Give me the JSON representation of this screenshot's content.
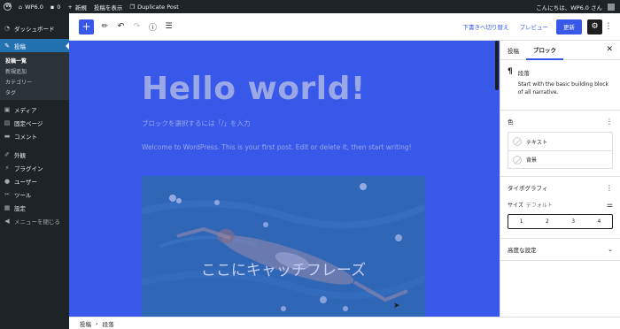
{
  "adminbar": {
    "site_name": "WP6.0",
    "comments_count": "0",
    "new_label": "新規",
    "view_post_label": "投稿を表示",
    "duplicate_label": "Duplicate Post",
    "greeting": "こんにちは、WP6.0 さん"
  },
  "sidebar": {
    "dashboard": "ダッシュボード",
    "posts": "投稿",
    "posts_sub": [
      "投稿一覧",
      "新規追加",
      "カテゴリー",
      "タグ"
    ],
    "media": "メディア",
    "pages": "固定ページ",
    "comments": "コメント",
    "appearance": "外観",
    "plugins": "プラグイン",
    "users": "ユーザー",
    "tools": "ツール",
    "settings": "設定",
    "collapse": "メニューを閉じる"
  },
  "toolbar": {
    "add_icon": "+",
    "switch_draft": "下書きへ切り替え",
    "preview": "プレビュー",
    "update": "更新"
  },
  "canvas": {
    "title": "Hello world!",
    "placeholder": "ブロックを選択するには「/」を入力",
    "paragraph": "Welcome to WordPress. This is your first post. Edit or delete it, then start writing!",
    "cover_text": "ここにキャッチフレーズ"
  },
  "breadcrumb": {
    "root": "投稿",
    "separator": "›",
    "current": "段落"
  },
  "settings_panel": {
    "tab_post": "投稿",
    "tab_block": "ブロック",
    "block_name": "段落",
    "block_desc": "Start with the basic building block of all narrative.",
    "color_heading": "色",
    "color_text": "テキスト",
    "color_background": "背景",
    "typography_heading": "タイポグラフィ",
    "size_label": "サイズ",
    "size_default": "デフォルト",
    "size_options": [
      "1",
      "2",
      "3",
      "4"
    ],
    "advanced_heading": "高度な設定"
  },
  "colors": {
    "accent": "#3858e9",
    "admin_dark": "#1d2327",
    "menu_active": "#2271b1"
  }
}
